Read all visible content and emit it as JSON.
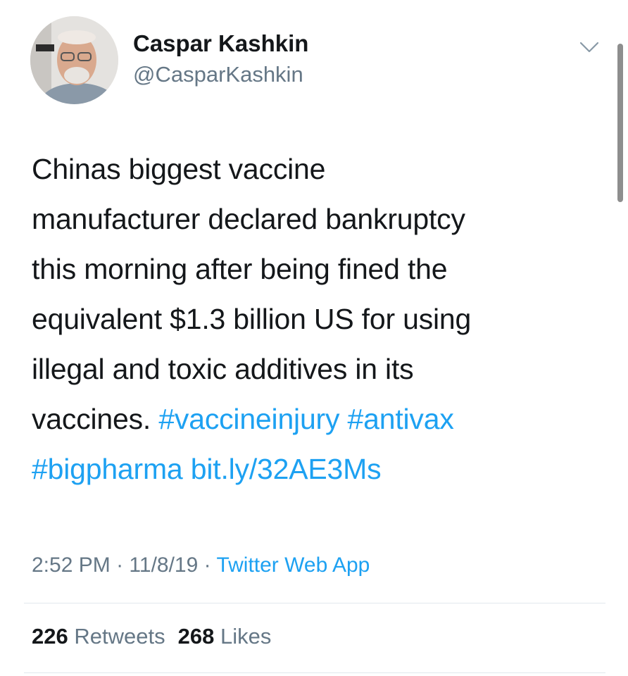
{
  "author": {
    "name": "Caspar Kashkin",
    "handle": "@CasparKashkin"
  },
  "tweet": {
    "lines": [
      "Chinas biggest vaccine",
      "manufacturer declared bankruptcy",
      "this morning after being fined the",
      "equivalent $1.3 billion US for using",
      "illegal and toxic additives in its"
    ],
    "line6_text": "vaccines. ",
    "hashtag1": "#vaccineinjury",
    "hashtag2": "#antivax",
    "hashtag3": "#bigpharma",
    "link": "bit.ly/32AE3Ms"
  },
  "meta": {
    "time": "2:52 PM",
    "separator": "·",
    "date": "11/8/19",
    "source": "Twitter Web App"
  },
  "stats": {
    "retweets_count": "226",
    "retweets_label": "Retweets",
    "likes_count": "268",
    "likes_label": "Likes"
  },
  "icons": {
    "menu": "chevron-down-icon"
  },
  "colors": {
    "link": "#1da1f2",
    "secondary": "#657786",
    "text": "#14171a",
    "divider": "#e1e8ed"
  }
}
